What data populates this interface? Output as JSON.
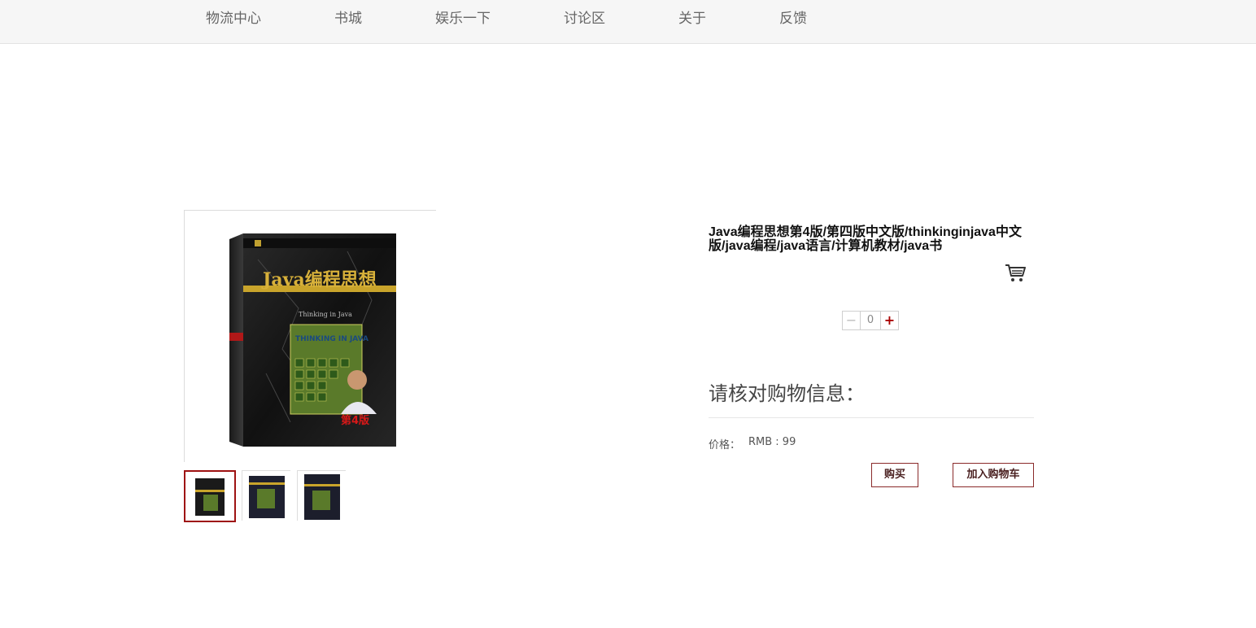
{
  "nav": {
    "items": [
      {
        "label": "物流中心"
      },
      {
        "label": "书城"
      },
      {
        "label": "娱乐一下"
      },
      {
        "label": "讨论区"
      },
      {
        "label": "关于"
      },
      {
        "label": "反馈"
      }
    ]
  },
  "product": {
    "title": "Java编程思想第4版/第四版中文版/thinkinginjava中文版/java编程/java语言/计算机教材/java书",
    "cover": {
      "title_cn": "Java编程思想",
      "title_en": "Thinking in Java",
      "cover_art_text": "THINKING IN JAVA",
      "edition_badge": "第4版"
    },
    "quantity": {
      "minus_label": "−",
      "value": "0",
      "plus_label": "+"
    }
  },
  "checkout": {
    "heading": "请核对购物信息：",
    "price_label": "价格：",
    "price_value": "RMB : 99",
    "buy_label": "购买",
    "add_to_cart_label": "加入购物车"
  },
  "colors": {
    "accent": "#9e1212",
    "nav_bg": "#f6f6f6",
    "text": "#444444"
  }
}
